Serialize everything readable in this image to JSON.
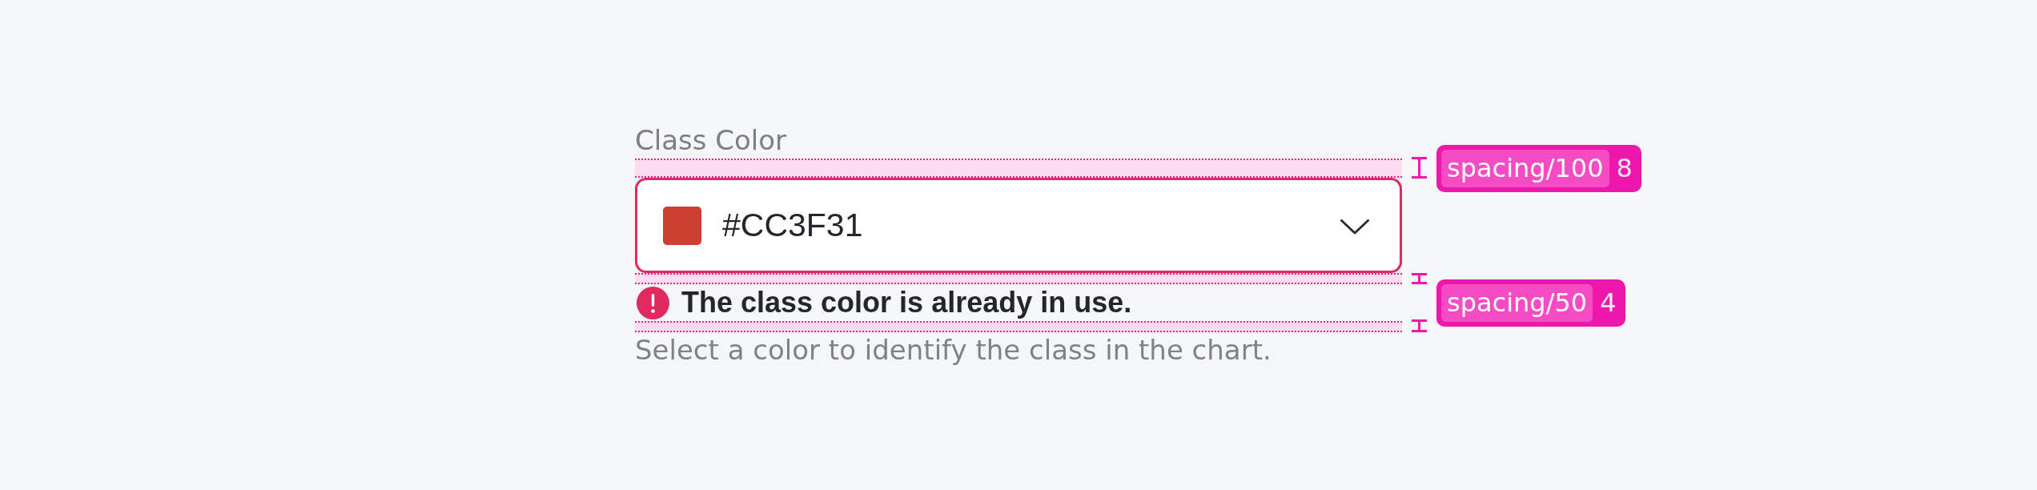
{
  "form_field": {
    "label": "Class Color",
    "value": "#CC3F31",
    "color": "#cc3f31",
    "invalid": true,
    "error_message": "The class color is already in use.",
    "helper_text": "Select a color to identify the class in the chart."
  },
  "spacing_annotations": [
    {
      "token": "spacing/100",
      "value": "8"
    },
    {
      "token": "spacing/50",
      "value": "4"
    }
  ]
}
